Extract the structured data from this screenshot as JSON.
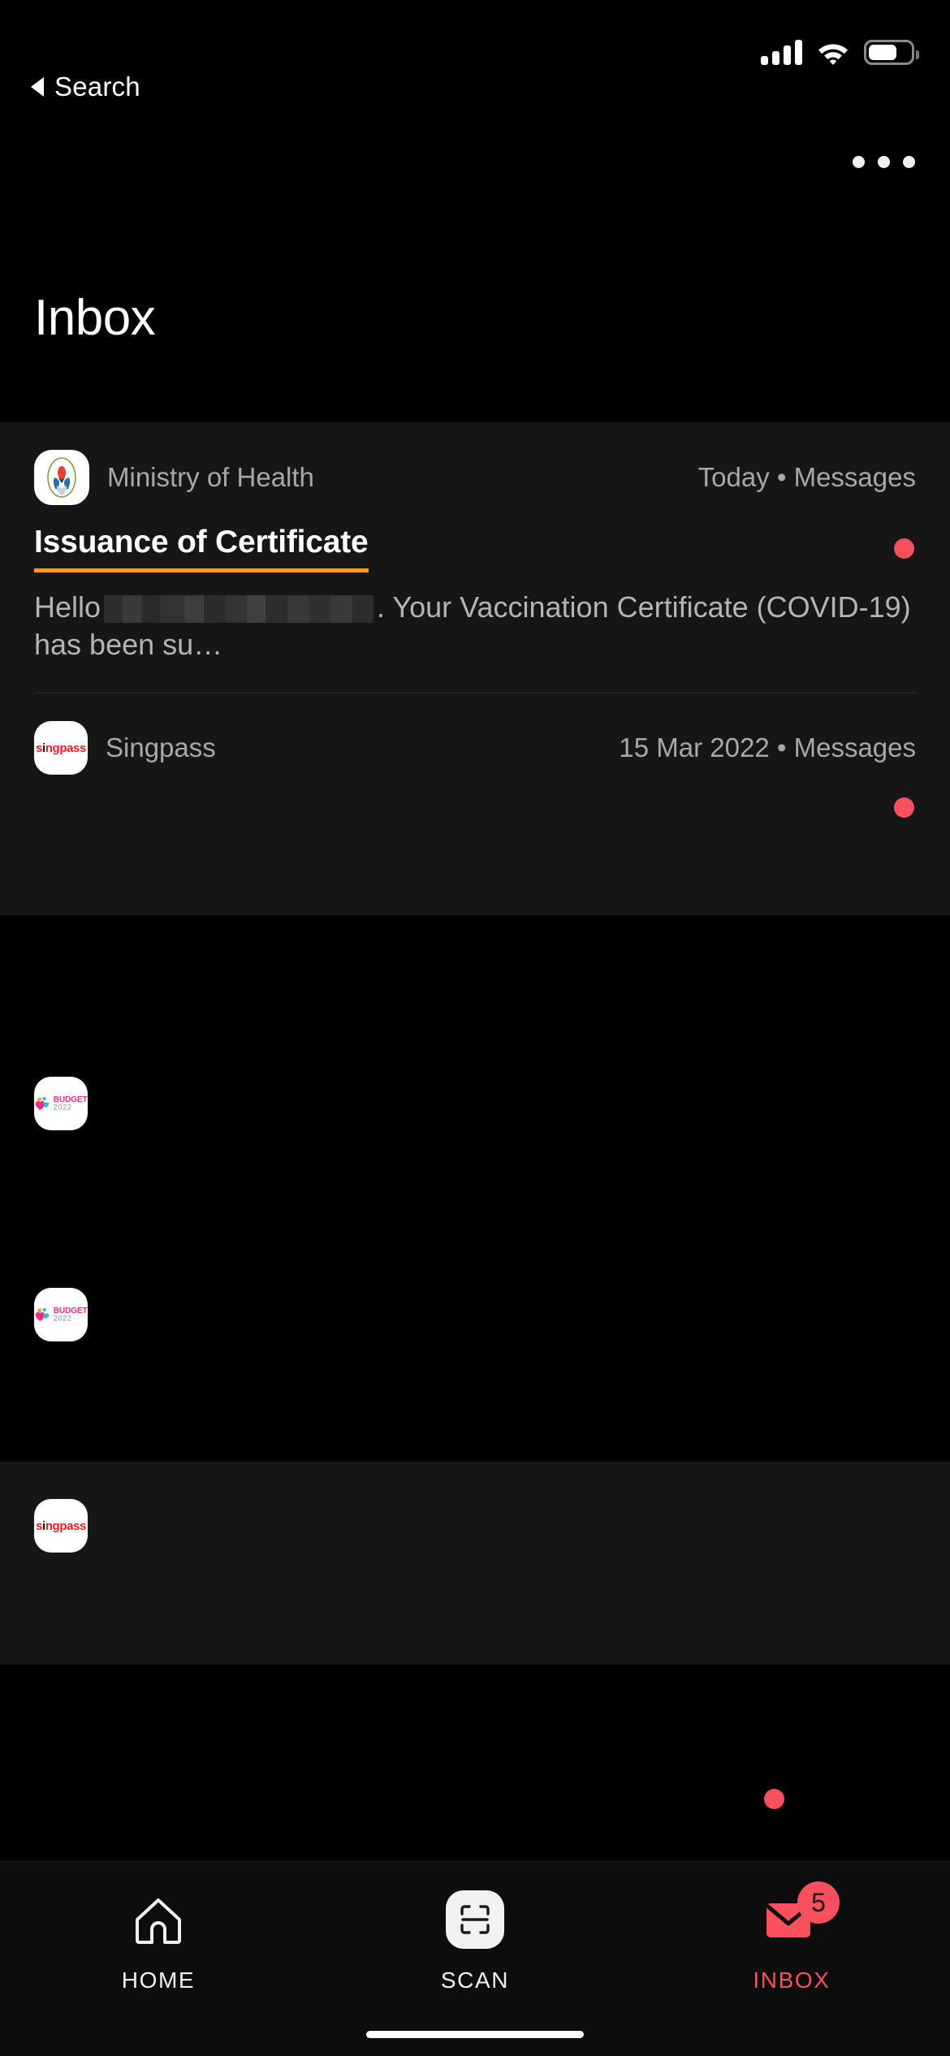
{
  "status_bar": {
    "signal_icon": "cellular-signal-icon",
    "signal_bars": 4,
    "wifi_icon": "wifi-icon",
    "battery_icon": "battery-icon",
    "battery_level_percent": 60
  },
  "back_link": {
    "label": "Search",
    "icon": "back-triangle-icon"
  },
  "more_menu": {
    "icon": "more-horizontal-icon"
  },
  "header": {
    "title": "Inbox"
  },
  "colors": {
    "accent_orange": "#f79a22",
    "unread_red": "#f8505c",
    "background": "#000000",
    "card_background": "#161616",
    "singpass_red": "#eb1c24"
  },
  "messages": [
    {
      "logo_icon": "ministry-of-health-logo",
      "sender": "Ministry of Health",
      "meta": "Today • Messages",
      "subject": "Issuance of Certificate",
      "preview_before": "Hello",
      "preview_redacted": "[redacted-name]",
      "preview_after": ". Your Vaccination Certificate (COVID-19) has been su…",
      "unread": true
    },
    {
      "logo_icon": "singpass-logo",
      "sender": "Singpass",
      "meta": "15 Mar 2022 • Messages",
      "subject": "",
      "preview_before": "",
      "preview_redacted": "",
      "preview_after": "",
      "unread": true
    },
    {
      "logo_icon": "budget-2022-logo",
      "sender": "",
      "meta": "",
      "subject": "",
      "preview_before": "",
      "preview_redacted": "",
      "preview_after": "",
      "unread": false
    },
    {
      "logo_icon": "budget-2022-logo",
      "sender": "",
      "meta": "",
      "subject": "",
      "preview_before": "",
      "preview_redacted": "",
      "preview_after": "",
      "unread": false
    },
    {
      "logo_icon": "singpass-logo",
      "sender": "",
      "meta": "",
      "subject": "",
      "preview_before": "",
      "preview_redacted": "",
      "preview_after": "",
      "unread": false
    }
  ],
  "tabbar": {
    "items": [
      {
        "label": "HOME",
        "icon": "home-icon",
        "active": false,
        "badge": ""
      },
      {
        "label": "SCAN",
        "icon": "scan-icon",
        "active": false,
        "badge": ""
      },
      {
        "label": "INBOX",
        "icon": "envelope-icon",
        "active": true,
        "badge": "5"
      }
    ]
  },
  "logo_text": {
    "singpass": "singpass",
    "budget_line1": "BUDGET",
    "budget_line2": "2022"
  }
}
